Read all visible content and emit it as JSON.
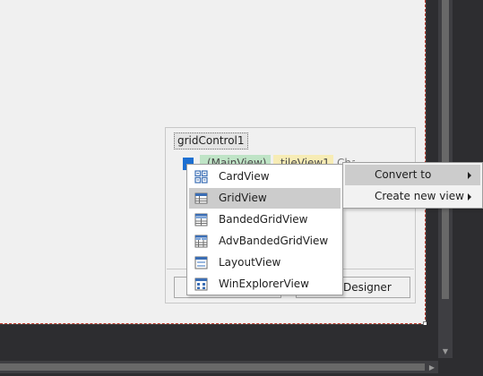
{
  "grid_control": {
    "title": "gridControl1",
    "main_view_chip": "(MainView)",
    "tile_view_chip": "tileView1",
    "change_text": "Change view",
    "designer_button": "Designer"
  },
  "views_menu": {
    "items": [
      {
        "label": "CardView",
        "icon": "card-view-icon"
      },
      {
        "label": "GridView",
        "icon": "grid-view-icon",
        "selected": true
      },
      {
        "label": "BandedGridView",
        "icon": "banded-grid-view-icon"
      },
      {
        "label": "AdvBandedGridView",
        "icon": "adv-banded-grid-view-icon"
      },
      {
        "label": "LayoutView",
        "icon": "layout-view-icon"
      },
      {
        "label": "WinExplorerView",
        "icon": "win-explorer-view-icon"
      }
    ]
  },
  "context_menu": {
    "items": [
      {
        "label": "Convert to",
        "submenu": true
      },
      {
        "label": "Create new view",
        "submenu": true
      }
    ]
  },
  "colors": {
    "accent_blue": "#1d6fd1",
    "selection": "#cccccc",
    "main_view_chip": "#bfe4c6",
    "tile_view_chip": "#f7ecb5",
    "selection_border": "#c0392b"
  }
}
